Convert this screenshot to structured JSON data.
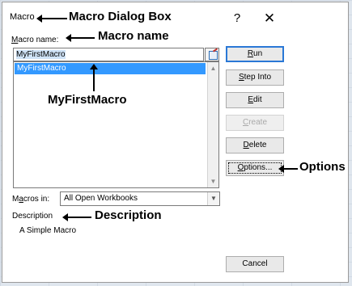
{
  "dialog": {
    "title": "Macro",
    "help_glyph": "?",
    "close_glyph": "✕"
  },
  "macro_name": {
    "label_key": "M",
    "label_rest": "acro name:",
    "value": "MyFirstMacro"
  },
  "macro_list": {
    "items": [
      "MyFirstMacro"
    ],
    "selected_index": 0
  },
  "buttons": {
    "run": {
      "key": "R",
      "rest": "un"
    },
    "step_into": {
      "key": "S",
      "rest": "tep Into"
    },
    "edit": {
      "key": "E",
      "rest": "dit"
    },
    "create": {
      "key": "C",
      "rest": "reate"
    },
    "delete": {
      "key": "D",
      "rest": "elete"
    },
    "options": {
      "key": "O",
      "rest": "ptions..."
    },
    "cancel": "Cancel"
  },
  "macros_in": {
    "label_pre": "M",
    "label_key": "a",
    "label_rest": "cros in:",
    "value": "All Open Workbooks"
  },
  "description": {
    "label": "Description",
    "text": "A Simple Macro"
  },
  "annotations": {
    "dialog_box": "Macro Dialog Box",
    "macro_name": "Macro name",
    "my_first_macro": "MyFirstMacro",
    "options": "Options",
    "description": "Description"
  }
}
